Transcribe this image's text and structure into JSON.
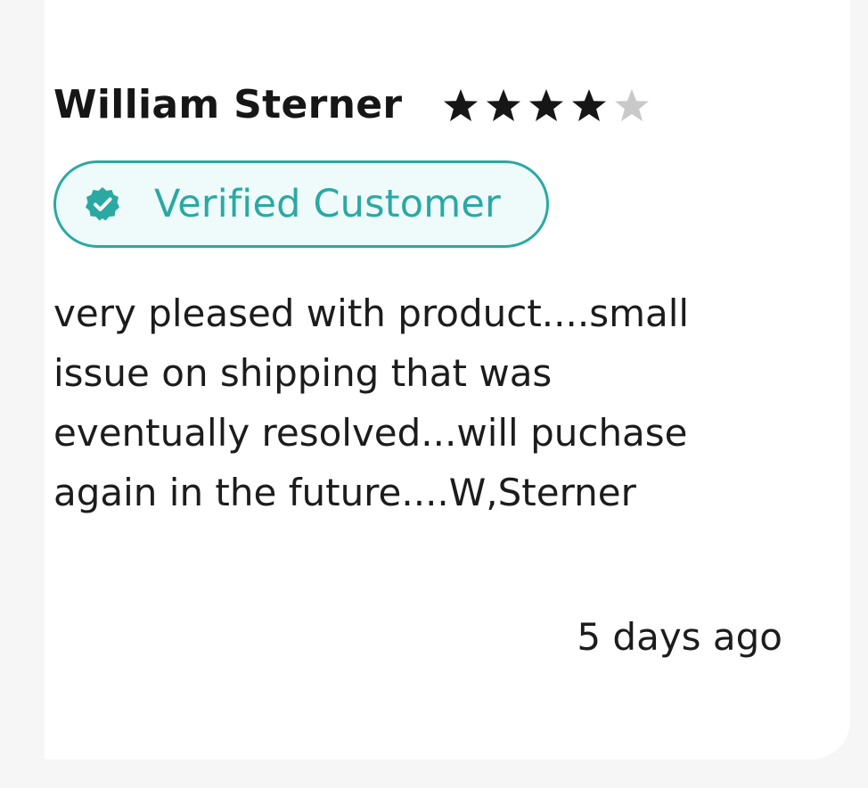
{
  "review": {
    "author": "William Sterner",
    "rating": 4,
    "rating_max": 5,
    "badge_label": "Verified Customer",
    "badge_icon": "verified-check-icon",
    "body_lines": [
      "very pleased with product....small",
      "issue on shipping that was",
      "eventually resolved...will puchase",
      "again in the future....W,Sterner"
    ],
    "timestamp": "5 days ago"
  },
  "colors": {
    "accent": "#2aa9a3",
    "badge_background": "#eefbfa",
    "star_filled": "#161616",
    "star_empty": "#c9c9c9",
    "text": "#1c1c1c",
    "page_background": "#f7f6f7",
    "card_background": "#ffffff"
  }
}
